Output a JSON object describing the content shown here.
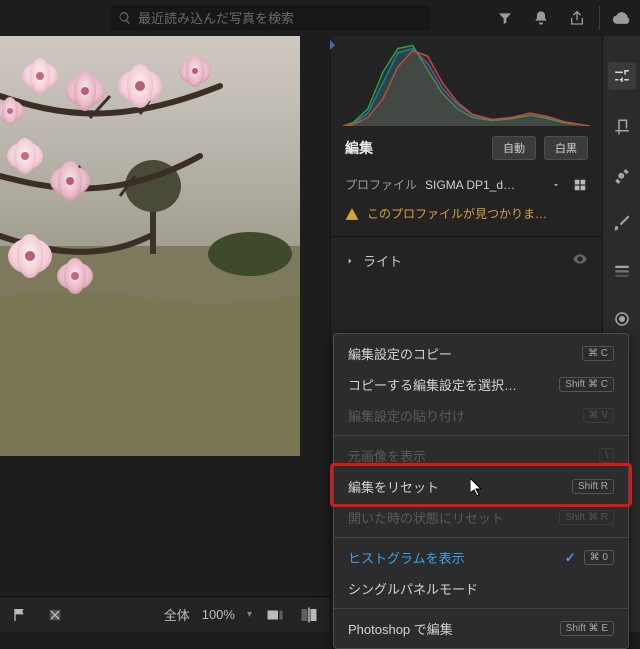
{
  "search": {
    "placeholder": "最近読み込んだ写真を検索"
  },
  "panel": {
    "edit_title": "編集",
    "btn_auto": "自動",
    "btn_bw": "白黒",
    "profile_label": "プロファイル",
    "profile_value": "SIGMA DP1_d…",
    "profile_warning": "このプロファイルが見つかりま…",
    "light_label": "ライト"
  },
  "menu": {
    "copy": {
      "label": "編集設定のコピー",
      "kbd": "⌘ C"
    },
    "copy_select": {
      "label": "コピーする編集設定を選択…",
      "kbd": "Shift ⌘ C"
    },
    "paste": {
      "label": "編集設定の貼り付け",
      "kbd": "⌘ V"
    },
    "show_orig": {
      "label": "元画像を表示",
      "kbd": "\\"
    },
    "reset": {
      "label": "編集をリセット",
      "kbd": "Shift R"
    },
    "reset_open": {
      "label": "開いた時の状態にリセット",
      "kbd": "Shift ⌘ R"
    },
    "show_histo": {
      "label": "ヒストグラムを表示",
      "kbd": "⌘ 0"
    },
    "single_panel": {
      "label": "シングルパネルモード"
    },
    "ps_edit": {
      "label": "Photoshop で編集",
      "kbd": "Shift ⌘ E"
    }
  },
  "bottom": {
    "scope": "全体",
    "zoom": "100%"
  },
  "chart_data": {
    "type": "area",
    "title": "Histogram",
    "xlabel": "",
    "ylabel": "",
    "xlim": [
      0,
      255
    ],
    "ylim": [
      0,
      100
    ],
    "x": [
      0,
      16,
      32,
      48,
      64,
      80,
      96,
      112,
      128,
      144,
      160,
      176,
      192,
      208,
      224,
      240,
      255
    ],
    "series": [
      {
        "name": "R",
        "values": [
          0,
          2,
          8,
          18,
          40,
          72,
          90,
          70,
          45,
          28,
          16,
          10,
          6,
          4,
          2,
          1,
          0
        ]
      },
      {
        "name": "G",
        "values": [
          0,
          3,
          10,
          24,
          55,
          88,
          95,
          60,
          35,
          20,
          12,
          8,
          5,
          3,
          2,
          1,
          0
        ]
      },
      {
        "name": "B",
        "values": [
          0,
          4,
          14,
          38,
          78,
          92,
          70,
          40,
          22,
          14,
          9,
          6,
          4,
          3,
          2,
          1,
          0
        ]
      }
    ]
  }
}
